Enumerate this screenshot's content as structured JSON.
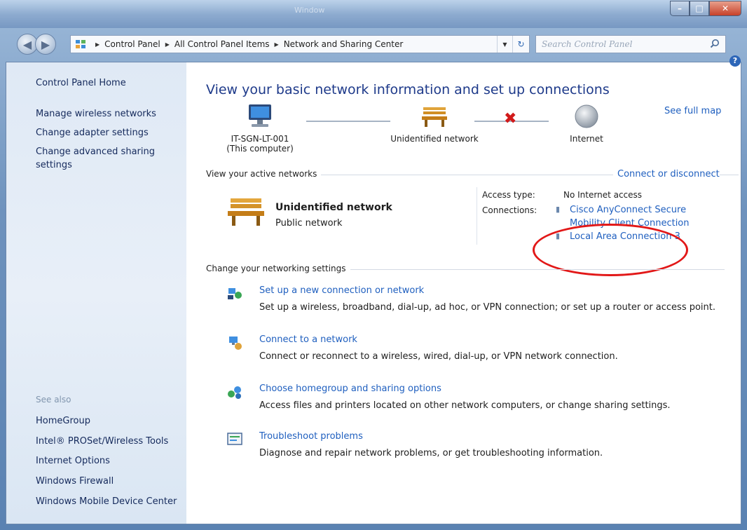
{
  "window": {
    "title": "Window"
  },
  "breadcrumb": [
    "Control Panel",
    "All Control Panel Items",
    "Network and Sharing Center"
  ],
  "search": {
    "placeholder": "Search Control Panel"
  },
  "sidebar": {
    "home": "Control Panel Home",
    "links": [
      "Manage wireless networks",
      "Change adapter settings",
      "Change advanced sharing settings"
    ],
    "see_also_title": "See also",
    "see_also": [
      "HomeGroup",
      "Intel® PROSet/Wireless Tools",
      "Internet Options",
      "Windows Firewall",
      "Windows Mobile Device Center"
    ]
  },
  "main": {
    "title": "View your basic network information and set up connections",
    "see_full_map": "See full map",
    "map": {
      "computer_name": "IT-SGN-LT-001",
      "computer_sub": "(This computer)",
      "network": "Unidentified network",
      "internet": "Internet"
    },
    "active_header": "View your active networks",
    "connect_disconnect": "Connect or disconnect",
    "active_network": {
      "name": "Unidentified network",
      "type": "Public network",
      "access_label": "Access type:",
      "access_value": "No Internet access",
      "connections_label": "Connections:",
      "connections": [
        "Cisco AnyConnect Secure",
        "Mobility Client Connection",
        "Local Area Connection 3"
      ]
    },
    "change_header": "Change your networking settings",
    "tasks": [
      {
        "title": "Set up a new connection or network",
        "desc": "Set up a wireless, broadband, dial-up, ad hoc, or VPN connection; or set up a router or access point.",
        "icon": "new-connection-icon"
      },
      {
        "title": "Connect to a network",
        "desc": "Connect or reconnect to a wireless, wired, dial-up, or VPN network connection.",
        "icon": "connect-network-icon"
      },
      {
        "title": "Choose homegroup and sharing options",
        "desc": "Access files and printers located on other network computers, or change sharing settings.",
        "icon": "homegroup-icon"
      },
      {
        "title": "Troubleshoot problems",
        "desc": "Diagnose and repair network problems, or get troubleshooting information.",
        "icon": "troubleshoot-icon"
      }
    ]
  },
  "colors": {
    "link": "#1f5fbf",
    "title": "#1e3a8a",
    "annotation": "#e21818"
  }
}
